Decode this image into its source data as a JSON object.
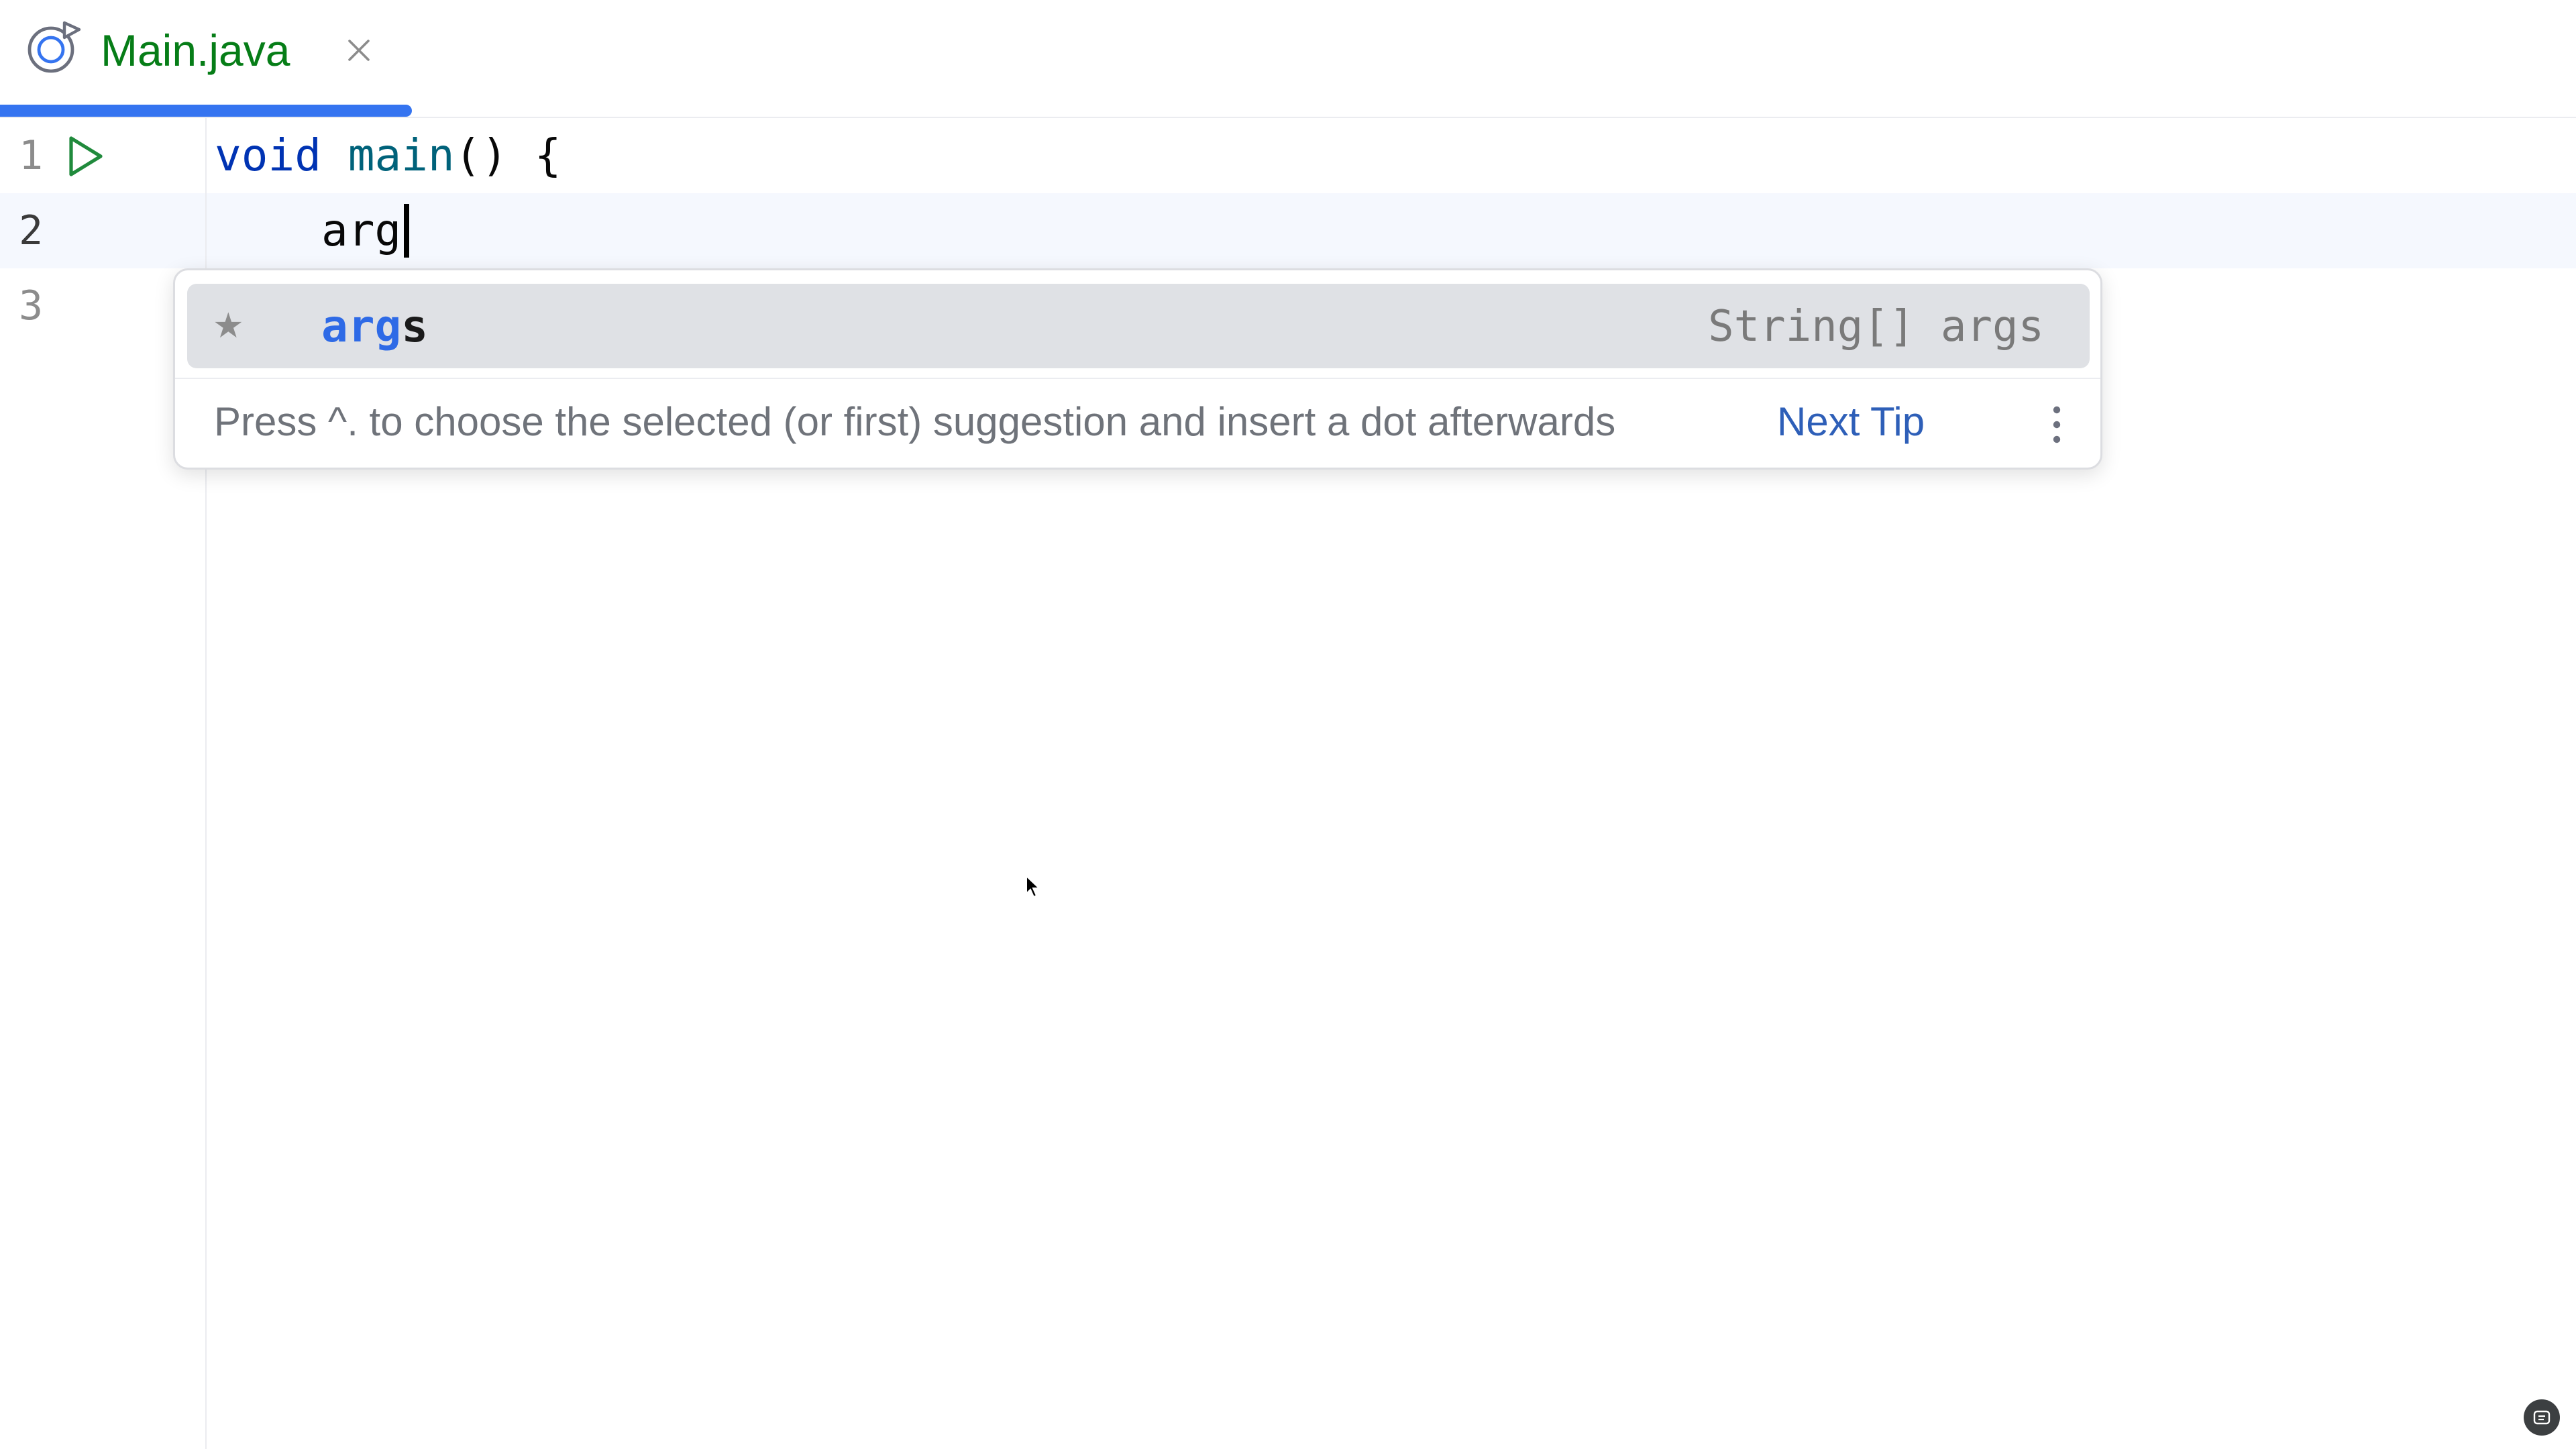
{
  "tab": {
    "title": "Main.java",
    "icon": "java-class-icon",
    "close_icon": "close-icon",
    "accent": "#3574f0",
    "title_color": "#067d17"
  },
  "editor": {
    "line_numbers": [
      "1",
      "2",
      "3"
    ],
    "current_line": 2,
    "line1": {
      "keyword": "void",
      "method": "main",
      "rest": "() {"
    },
    "line2": {
      "indent": "    ",
      "text": "arg"
    },
    "run_icon": "run-gutter-icon"
  },
  "completion": {
    "items": [
      {
        "match": "arg",
        "rest": "s",
        "type": "String[] args",
        "star_icon": "star-icon"
      }
    ],
    "tip": {
      "text": "Press ^. to choose the selected (or first) suggestion and insert a dot afterwards",
      "link": "Next Tip"
    },
    "more_icon": "more-vertical-icon",
    "highlight_color": "#2e6ae6"
  }
}
